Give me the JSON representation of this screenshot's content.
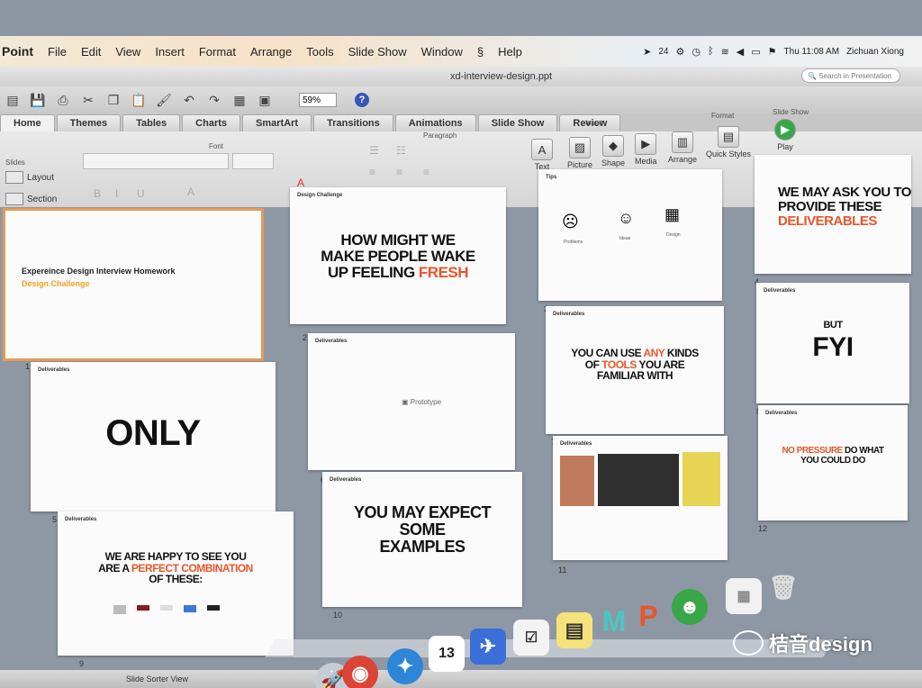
{
  "menu": {
    "app": "Point",
    "items": [
      "File",
      "Edit",
      "View",
      "Insert",
      "Format",
      "Arrange",
      "Tools",
      "Slide Show",
      "Window",
      "Help"
    ],
    "status_right": {
      "battery_count": "24",
      "datetime": "Thu 11:08 AM",
      "user": "Zichuan Xiong"
    }
  },
  "window": {
    "document_title": "xd-interview-design.ppt",
    "search_placeholder": "Search in Presentation"
  },
  "toolbar": {
    "zoom": "59%",
    "help": "?"
  },
  "ribbon": {
    "tabs": [
      "Home",
      "Themes",
      "Tables",
      "Charts",
      "SmartArt",
      "Transitions",
      "Animations",
      "Slide Show",
      "Review"
    ],
    "groups": {
      "font": "Font",
      "paragraph": "Paragraph",
      "insert": "Insert",
      "format": "Format",
      "slide_show": "Slide Show",
      "slides": "Slides"
    },
    "buttons": {
      "layout": "Layout",
      "section": "Section",
      "text": "Text",
      "picture": "Picture",
      "shape": "Shape",
      "media": "Media",
      "arrange": "Arrange",
      "quick_styles": "Quick Styles",
      "play": "Play"
    }
  },
  "slides": [
    {
      "num": "1",
      "title": "Expereince Design Interview Homework",
      "subtitle": "Design Challenge"
    },
    {
      "num": "2",
      "tag": "Design Challenge",
      "l1": "HOW MIGHT WE",
      "l2": "MAKE PEOPLE WAKE",
      "l3a": "UP FEELING ",
      "l3b": "FRESH"
    },
    {
      "num": "3",
      "tag": "Tips",
      "c1": "Problems",
      "c2": "Ideas",
      "c3": "Design"
    },
    {
      "num": "4",
      "tag": "",
      "l1": "WE MAY ASK YOU TO",
      "l2": "PROVIDE THESE",
      "l3": "DELIVERABLES"
    },
    {
      "num": "5",
      "tag": "Deliverables",
      "text": "ONLY"
    },
    {
      "num": "6",
      "tag": "Deliverables",
      "text": "Prototype"
    },
    {
      "num": "7",
      "tag": "Deliverables",
      "l1a": "YOU CAN USE ",
      "l1b": "ANY",
      "l1c": " KINDS",
      "l2a": "OF ",
      "l2b": "TOOLS",
      "l2c": " YOU ARE",
      "l3": "FAMILIAR WITH"
    },
    {
      "num": "8",
      "tag": "Deliverables",
      "l1": "BUT",
      "l2": "FYI"
    },
    {
      "num": "9",
      "tag": "Deliverables",
      "l1": "WE ARE HAPPY TO SEE YOU",
      "l2a": "ARE A ",
      "l2b": "PERFECT COMBINATION",
      "l3": "OF THESE:"
    },
    {
      "num": "10",
      "tag": "Deliverables",
      "l1": "YOU MAY EXPECT",
      "l2": "SOME",
      "l3": "EXAMPLES"
    },
    {
      "num": "11",
      "tag": "Deliverables"
    },
    {
      "num": "12",
      "tag": "Deliverables",
      "l1a": "NO PRESSURE",
      "l1b": " DO WHAT",
      "l2": "YOU COULD DO"
    }
  ],
  "status_bar": {
    "view": "Slide Sorter View"
  },
  "watermark": "桔音design",
  "dock": {
    "calendar_day": "13"
  }
}
